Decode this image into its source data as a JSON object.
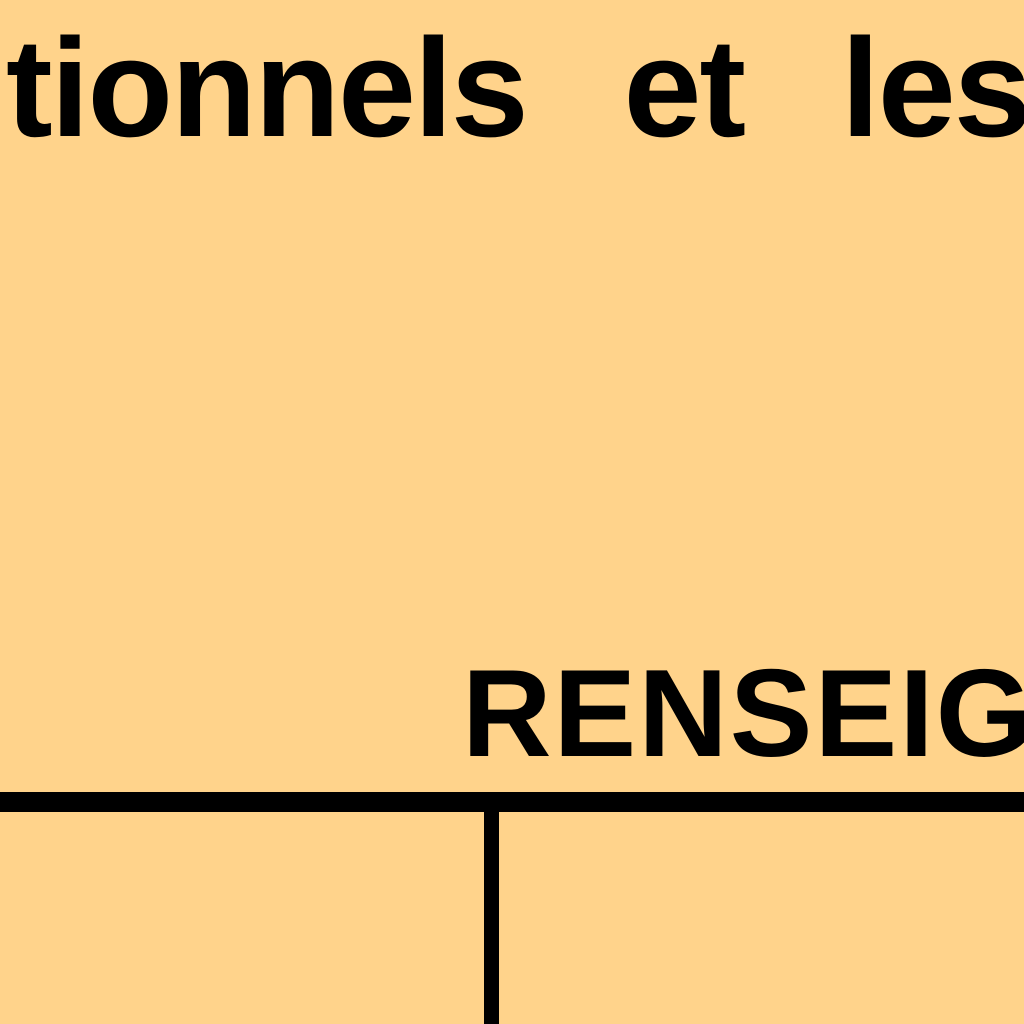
{
  "document": {
    "body_text": "tionnels et les",
    "section_heading": "RENSEIGN"
  },
  "colors": {
    "paper": "#FFD38B",
    "ink": "#000000"
  }
}
